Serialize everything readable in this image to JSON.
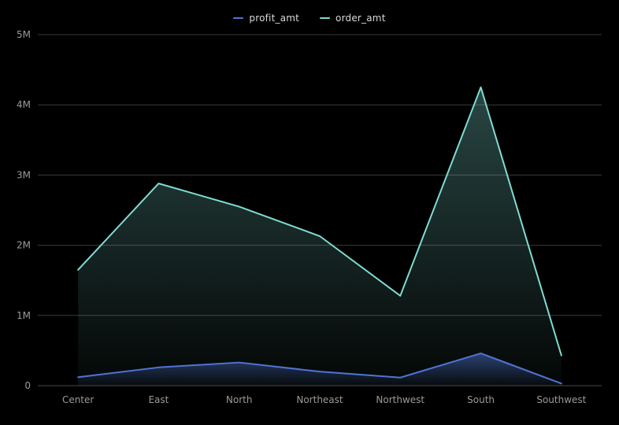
{
  "chart_data": {
    "type": "area",
    "title": "",
    "xlabel": "",
    "ylabel": "",
    "categories": [
      "Center",
      "East",
      "North",
      "Northeast",
      "Northwest",
      "South",
      "Southwest"
    ],
    "series": [
      {
        "name": "order_amt",
        "color": "#7fdcd2",
        "values": [
          1650000,
          2880000,
          2550000,
          2130000,
          1280000,
          4250000,
          430000
        ]
      },
      {
        "name": "profit_amt",
        "color": "#4f74d4",
        "values": [
          120000,
          260000,
          330000,
          200000,
          115000,
          460000,
          30000
        ]
      }
    ],
    "ylim": [
      0,
      5000000
    ],
    "ytick_values": [
      0,
      1000000,
      2000000,
      3000000,
      4000000,
      5000000
    ],
    "ytick_labels": [
      "0",
      "1M",
      "2M",
      "3M",
      "4M",
      "5M"
    ],
    "grid": true,
    "legend_position": "top",
    "colors": {
      "background": "#000000",
      "gridline": "#3a3a3a",
      "baseline": "#4a4a4a",
      "tick_text": "#9a9a9a",
      "legend_text": "#d9d9d9"
    }
  },
  "legend": {
    "items": [
      {
        "label": "profit_amt"
      },
      {
        "label": "order_amt"
      }
    ]
  }
}
